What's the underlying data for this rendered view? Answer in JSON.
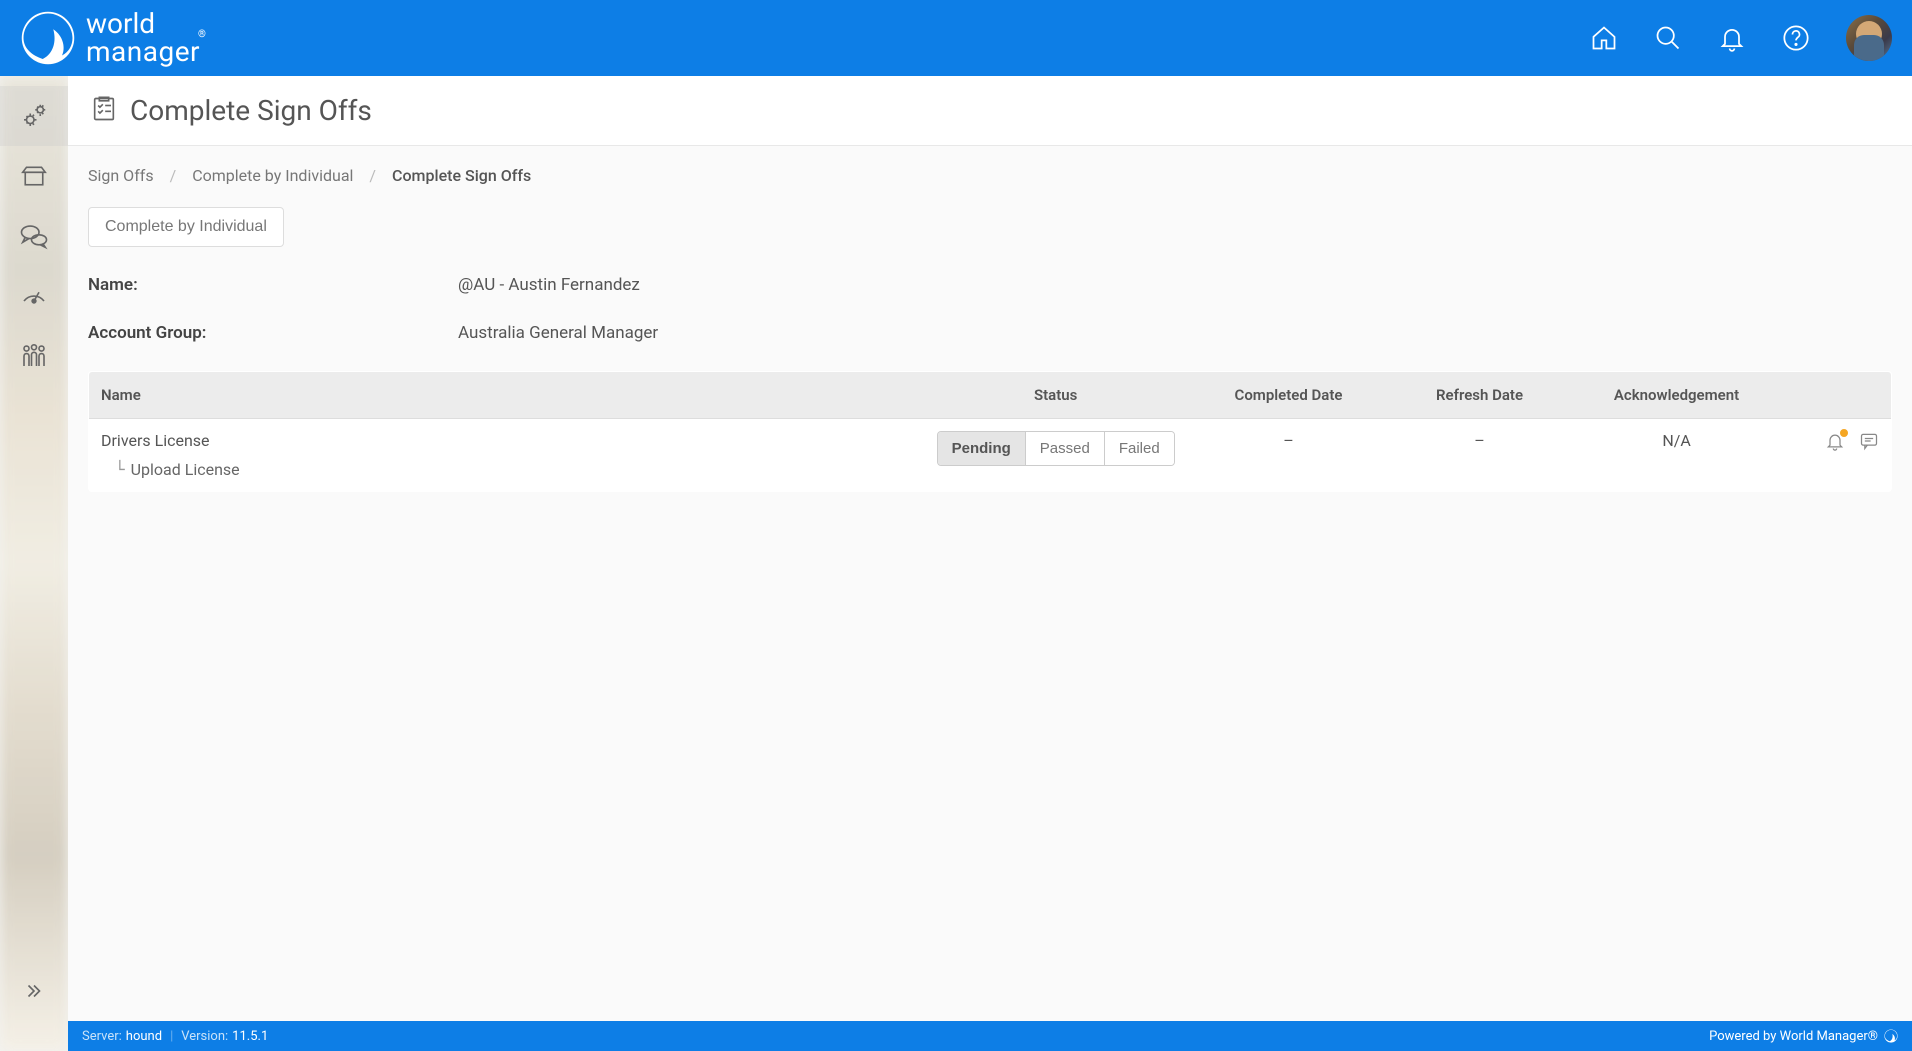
{
  "brand": {
    "line1": "world",
    "line2": "manager"
  },
  "page": {
    "title": "Complete Sign Offs"
  },
  "breadcrumb": {
    "items": [
      {
        "label": "Sign Offs"
      },
      {
        "label": "Complete by Individual"
      }
    ],
    "current": "Complete Sign Offs"
  },
  "subnav": {
    "complete_by_individual": "Complete by Individual"
  },
  "details": {
    "name_label": "Name:",
    "name_value": "@AU - Austin Fernandez",
    "group_label": "Account Group:",
    "group_value": "Australia General Manager"
  },
  "table": {
    "headers": {
      "name": "Name",
      "status": "Status",
      "completed": "Completed Date",
      "refresh": "Refresh Date",
      "ack": "Acknowledgement"
    },
    "row": {
      "name": "Drivers License",
      "child": "Upload License",
      "status_pending": "Pending",
      "status_passed": "Passed",
      "status_failed": "Failed",
      "completed": "–",
      "refresh": "–",
      "ack": "N/A"
    }
  },
  "footer": {
    "server_label": "Server:",
    "server_value": "hound",
    "version_label": "Version:",
    "version_value": "11.5.1",
    "powered": "Powered by World Manager®"
  }
}
